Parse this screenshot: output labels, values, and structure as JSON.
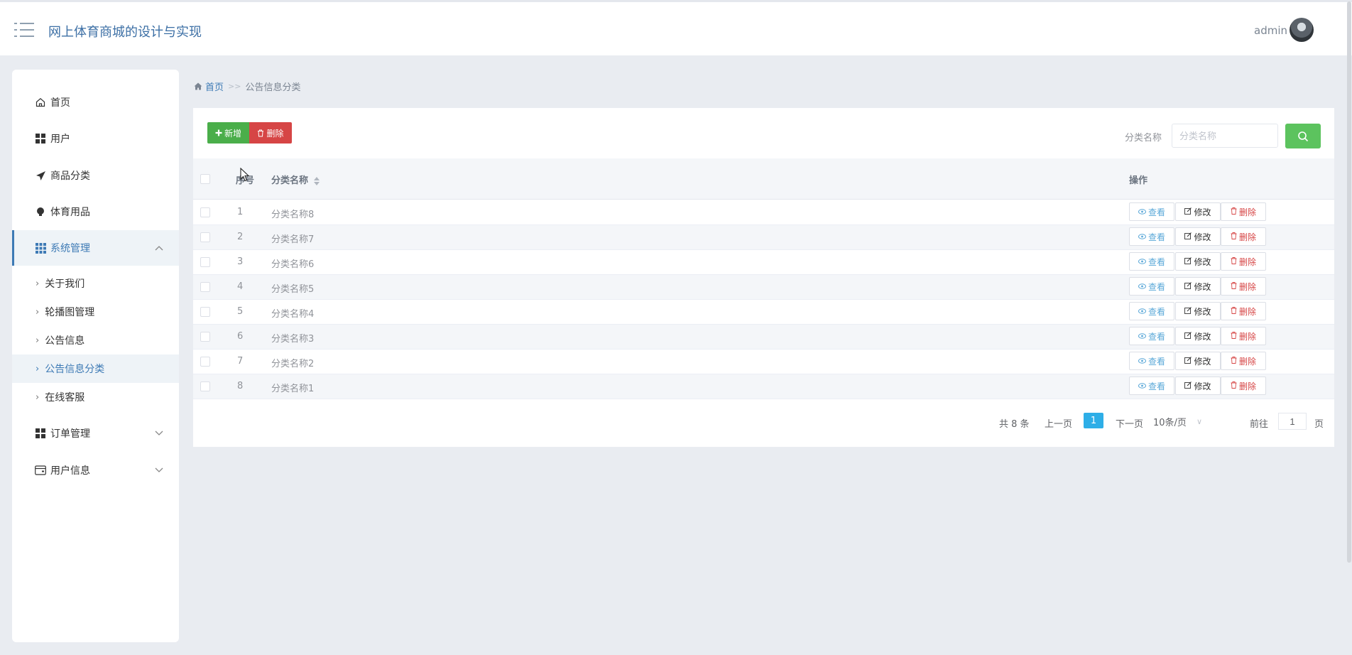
{
  "header": {
    "title": "网上体育商城的设计与实现",
    "user": "admin"
  },
  "sidebar": {
    "items": [
      {
        "label": "首页",
        "icon": "home-icon"
      },
      {
        "label": "用户",
        "icon": "grid-icon"
      },
      {
        "label": "商品分类",
        "icon": "paper-plane-icon"
      },
      {
        "label": "体育用品",
        "icon": "bulb-icon"
      },
      {
        "label": "系统管理",
        "icon": "apps-icon",
        "expanded": true
      },
      {
        "label": "订单管理",
        "icon": "grid-icon"
      },
      {
        "label": "用户信息",
        "icon": "wallet-icon"
      }
    ],
    "submenu": [
      {
        "label": "关于我们"
      },
      {
        "label": "轮播图管理"
      },
      {
        "label": "公告信息"
      },
      {
        "label": "公告信息分类",
        "active": true
      },
      {
        "label": "在线客服"
      }
    ]
  },
  "breadcrumb": {
    "home": "首页",
    "separator": ">>",
    "current": "公告信息分类"
  },
  "toolbar": {
    "add_label": "新增",
    "delete_label": "删除",
    "search_label": "分类名称",
    "search_placeholder": "分类名称"
  },
  "table": {
    "headers": {
      "index": "序号",
      "name": "分类名称",
      "ops": "操作"
    },
    "ops": {
      "view": "查看",
      "edit": "修改",
      "delete": "删除"
    },
    "rows": [
      {
        "index": "1",
        "name": "分类名称8"
      },
      {
        "index": "2",
        "name": "分类名称7"
      },
      {
        "index": "3",
        "name": "分类名称6"
      },
      {
        "index": "4",
        "name": "分类名称5"
      },
      {
        "index": "5",
        "name": "分类名称4"
      },
      {
        "index": "6",
        "name": "分类名称3"
      },
      {
        "index": "7",
        "name": "分类名称2"
      },
      {
        "index": "8",
        "name": "分类名称1"
      }
    ]
  },
  "pagination": {
    "total": "共 8 条",
    "prev": "上一页",
    "current_page": "1",
    "next": "下一页",
    "page_size": "10条/页",
    "goto_label": "前往",
    "goto_value": "1",
    "goto_unit": "页"
  },
  "colors": {
    "accent": "#3d7ab5",
    "add": "#4aae4a",
    "delete": "#d64545",
    "search": "#5cc35e",
    "page_active": "#2eaee7"
  }
}
